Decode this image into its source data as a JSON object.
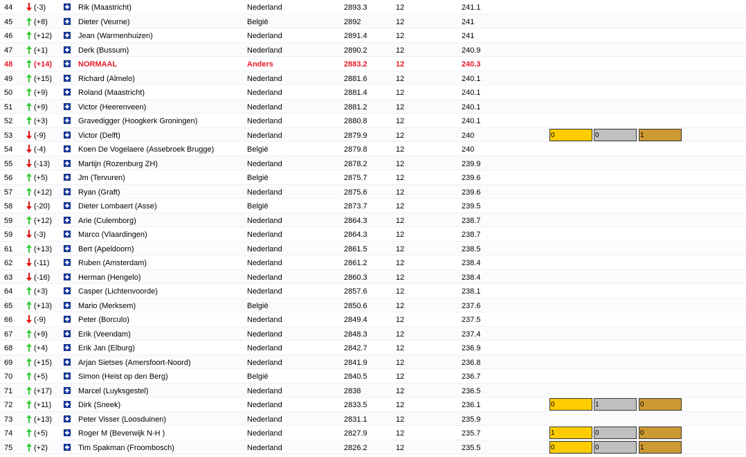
{
  "colors": {
    "up_arrow": "#33cc33",
    "down_arrow": "#dd1111",
    "highlight_text": "#e6192a",
    "flag_blue": "#1b3fa8",
    "gold": "#ffcc00",
    "silver": "#c0c0c0",
    "bronze": "#cc9933"
  },
  "icons": {
    "up": "arrow-up-icon",
    "down": "arrow-down-icon",
    "flag": "flag-icon"
  },
  "rows": [
    {
      "rank": "44",
      "dir": "down",
      "change": "(-3)",
      "name": "Rik (Maastricht)",
      "country": "Nederland",
      "score": "2893.3",
      "games": "12",
      "avg": "241.1"
    },
    {
      "rank": "45",
      "dir": "up",
      "change": "(+8)",
      "name": "Dieter (Veurne)",
      "country": "België",
      "score": "2892",
      "games": "12",
      "avg": "241"
    },
    {
      "rank": "46",
      "dir": "up",
      "change": "(+12)",
      "name": "Jean (Warmenhuizen)",
      "country": "Nederland",
      "score": "2891.4",
      "games": "12",
      "avg": "241"
    },
    {
      "rank": "47",
      "dir": "up",
      "change": "(+1)",
      "name": "Derk (Bussum)",
      "country": "Nederland",
      "score": "2890.2",
      "games": "12",
      "avg": "240.9"
    },
    {
      "rank": "48",
      "dir": "up",
      "change": "(+14)",
      "name": "NORMAAL",
      "country": "Anders",
      "score": "2883.2",
      "games": "12",
      "avg": "240.3",
      "highlight": true
    },
    {
      "rank": "49",
      "dir": "up",
      "change": "(+15)",
      "name": "Richard (Almelo)",
      "country": "Nederland",
      "score": "2881.6",
      "games": "12",
      "avg": "240.1"
    },
    {
      "rank": "50",
      "dir": "up",
      "change": "(+9)",
      "name": "Roland (Maastricht)",
      "country": "Nederland",
      "score": "2881.4",
      "games": "12",
      "avg": "240.1"
    },
    {
      "rank": "51",
      "dir": "up",
      "change": "(+9)",
      "name": "Victor (Heerenveen)",
      "country": "Nederland",
      "score": "2881.2",
      "games": "12",
      "avg": "240.1"
    },
    {
      "rank": "52",
      "dir": "up",
      "change": "(+3)",
      "name": "Gravedigger (Hoogkerk Groningen)",
      "country": "Nederland",
      "score": "2880.8",
      "games": "12",
      "avg": "240.1"
    },
    {
      "rank": "53",
      "dir": "down",
      "change": "(-9)",
      "name": "Victor (Delft)",
      "country": "Nederland",
      "score": "2879.9",
      "games": "12",
      "avg": "240",
      "medals": {
        "gold": "0",
        "silver": "0",
        "bronze": "1"
      }
    },
    {
      "rank": "54",
      "dir": "down",
      "change": "(-4)",
      "name": "Koen De Vogelaere (Assebroek Brugge)",
      "country": "België",
      "score": "2879.8",
      "games": "12",
      "avg": "240"
    },
    {
      "rank": "55",
      "dir": "down",
      "change": "(-13)",
      "name": "Martijn (Rozenburg ZH)",
      "country": "Nederland",
      "score": "2878.2",
      "games": "12",
      "avg": "239.9"
    },
    {
      "rank": "56",
      "dir": "up",
      "change": "(+5)",
      "name": "Jm (Tervuren)",
      "country": "België",
      "score": "2875.7",
      "games": "12",
      "avg": "239.6"
    },
    {
      "rank": "57",
      "dir": "up",
      "change": "(+12)",
      "name": "Ryan (Graft)",
      "country": "Nederland",
      "score": "2875.6",
      "games": "12",
      "avg": "239.6"
    },
    {
      "rank": "58",
      "dir": "down",
      "change": "(-20)",
      "name": "Dieter Lombaert (Asse)",
      "country": "België",
      "score": "2873.7",
      "games": "12",
      "avg": "239.5"
    },
    {
      "rank": "59",
      "dir": "up",
      "change": "(+12)",
      "name": "Arie (Culemborg)",
      "country": "Nederland",
      "score": "2864.3",
      "games": "12",
      "avg": "238.7"
    },
    {
      "rank": "59",
      "dir": "down",
      "change": "(-3)",
      "name": "Marco (Vlaardingen)",
      "country": "Nederland",
      "score": "2864.3",
      "games": "12",
      "avg": "238.7"
    },
    {
      "rank": "61",
      "dir": "up",
      "change": "(+13)",
      "name": "Bert (Apeldoorn)",
      "country": "Nederland",
      "score": "2861.5",
      "games": "12",
      "avg": "238.5"
    },
    {
      "rank": "62",
      "dir": "down",
      "change": "(-11)",
      "name": "Ruben (Amsterdam)",
      "country": "Nederland",
      "score": "2861.2",
      "games": "12",
      "avg": "238.4"
    },
    {
      "rank": "63",
      "dir": "down",
      "change": "(-16)",
      "name": "Herman (Hengelo)",
      "country": "Nederland",
      "score": "2860.3",
      "games": "12",
      "avg": "238.4"
    },
    {
      "rank": "64",
      "dir": "up",
      "change": "(+3)",
      "name": "Casper (Lichtenvoorde)",
      "country": "Nederland",
      "score": "2857.6",
      "games": "12",
      "avg": "238.1"
    },
    {
      "rank": "65",
      "dir": "up",
      "change": "(+13)",
      "name": "Mario (Merksem)",
      "country": "België",
      "score": "2850.6",
      "games": "12",
      "avg": "237.6"
    },
    {
      "rank": "66",
      "dir": "down",
      "change": "(-9)",
      "name": "Peter (Borculo)",
      "country": "Nederland",
      "score": "2849.4",
      "games": "12",
      "avg": "237.5"
    },
    {
      "rank": "67",
      "dir": "up",
      "change": "(+9)",
      "name": "Erik (Veendam)",
      "country": "Nederland",
      "score": "2848.3",
      "games": "12",
      "avg": "237.4"
    },
    {
      "rank": "68",
      "dir": "up",
      "change": "(+4)",
      "name": "Erik Jan (Elburg)",
      "country": "Nederland",
      "score": "2842.7",
      "games": "12",
      "avg": "236.9"
    },
    {
      "rank": "69",
      "dir": "up",
      "change": "(+15)",
      "name": "Arjan Sietses (Amersfoort-Noord)",
      "country": "Nederland",
      "score": "2841.9",
      "games": "12",
      "avg": "236.8"
    },
    {
      "rank": "70",
      "dir": "up",
      "change": "(+5)",
      "name": "Simon (Heist op den Berg)",
      "country": "België",
      "score": "2840.5",
      "games": "12",
      "avg": "236.7"
    },
    {
      "rank": "71",
      "dir": "up",
      "change": "(+17)",
      "name": "Marcel (Luyksgestel)",
      "country": "Nederland",
      "score": "2838",
      "games": "12",
      "avg": "236.5"
    },
    {
      "rank": "72",
      "dir": "up",
      "change": "(+11)",
      "name": "Dirk (Sneek)",
      "country": "Nederland",
      "score": "2833.5",
      "games": "12",
      "avg": "236.1",
      "medals": {
        "gold": "0",
        "silver": "1",
        "bronze": "0"
      }
    },
    {
      "rank": "73",
      "dir": "up",
      "change": "(+13)",
      "name": "Peter Visser (Loosduinen)",
      "country": "Nederland",
      "score": "2831.1",
      "games": "12",
      "avg": "235.9"
    },
    {
      "rank": "74",
      "dir": "up",
      "change": "(+5)",
      "name": "Roger M (Beverwijk N-H )",
      "country": "Nederland",
      "score": "2827.9",
      "games": "12",
      "avg": "235.7",
      "medals": {
        "gold": "1",
        "silver": "0",
        "bronze": "0"
      }
    },
    {
      "rank": "75",
      "dir": "up",
      "change": "(+2)",
      "name": "Tim Spakman (Froombosch)",
      "country": "Nederland",
      "score": "2826.2",
      "games": "12",
      "avg": "235.5",
      "medals": {
        "gold": "0",
        "silver": "0",
        "bronze": "1"
      }
    }
  ]
}
